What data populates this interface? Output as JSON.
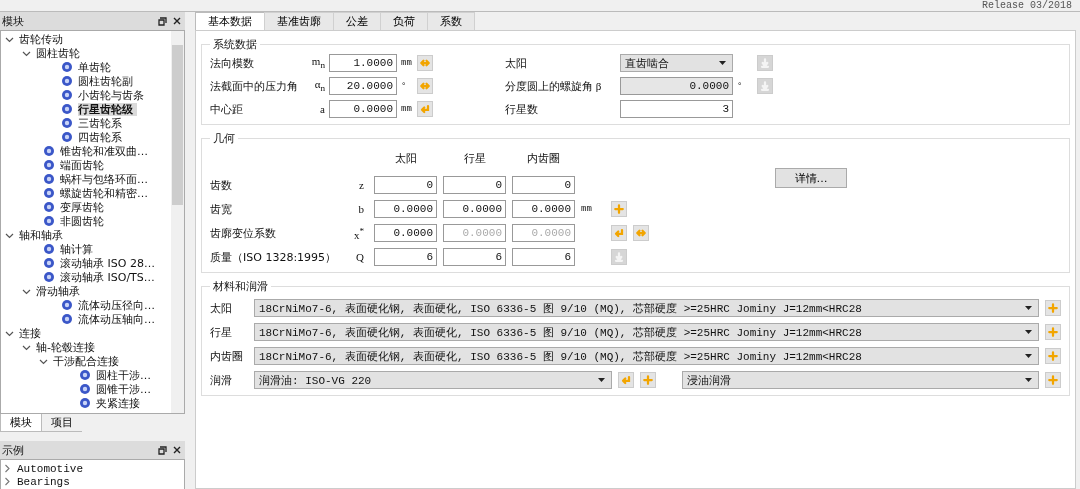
{
  "release": "Release 03/2018",
  "module_panel": {
    "title": "模块",
    "tree": [
      {
        "label": "齿轮传动",
        "expanded": true,
        "selected": false,
        "children": [
          {
            "label": "圆柱齿轮",
            "expanded": true,
            "selected": false,
            "children": [
              {
                "label": "单齿轮",
                "selected": false
              },
              {
                "label": "圆柱齿轮副",
                "selected": false
              },
              {
                "label": "小齿轮与齿条",
                "selected": false
              },
              {
                "label": "行星齿轮级",
                "selected": true
              },
              {
                "label": "三齿轮系",
                "selected": false
              },
              {
                "label": "四齿轮系",
                "selected": false
              }
            ]
          },
          {
            "label": "锥齿轮和准双曲…",
            "selected": false
          },
          {
            "label": "端面齿轮",
            "selected": false
          },
          {
            "label": "蜗杆与包络环面…",
            "selected": false
          },
          {
            "label": "螺旋齿轮和精密…",
            "selected": false
          },
          {
            "label": "变厚齿轮",
            "selected": false
          },
          {
            "label": "非圆齿轮",
            "selected": false
          }
        ]
      },
      {
        "label": "轴和轴承",
        "expanded": true,
        "selected": false,
        "children": [
          {
            "label": "轴计算",
            "selected": false
          },
          {
            "label": "滚动轴承 ISO 28…",
            "selected": false
          },
          {
            "label": "滚动轴承 ISO/TS…",
            "selected": false
          },
          {
            "label": "滑动轴承",
            "expanded": true,
            "selected": false,
            "children": [
              {
                "label": "流体动压径向…",
                "selected": false
              },
              {
                "label": "流体动压轴向…",
                "selected": false
              }
            ]
          }
        ]
      },
      {
        "label": "连接",
        "expanded": true,
        "selected": false,
        "children": [
          {
            "label": "轴-轮毂连接",
            "expanded": true,
            "selected": false,
            "children": [
              {
                "label": "干涉配合连接",
                "expanded": true,
                "selected": false,
                "children": [
                  {
                    "label": "圆柱干涉…",
                    "selected": false
                  },
                  {
                    "label": "圆锥干涉…",
                    "selected": false
                  },
                  {
                    "label": "夹紧连接",
                    "selected": false
                  }
                ]
              }
            ]
          }
        ]
      }
    ],
    "tabs": [
      {
        "label": "模块",
        "selected": true
      },
      {
        "label": "项目",
        "selected": false
      }
    ]
  },
  "examples_panel": {
    "title": "示例",
    "items": [
      {
        "label": "Automotive"
      },
      {
        "label": "Bearings"
      }
    ]
  },
  "tabs": [
    {
      "label": "基本数据",
      "selected": true
    },
    {
      "label": "基准齿廓",
      "selected": false
    },
    {
      "label": "公差",
      "selected": false
    },
    {
      "label": "负荷",
      "selected": false
    },
    {
      "label": "系数",
      "selected": false
    }
  ],
  "system_data": {
    "title": "系统数据",
    "left_rows": [
      {
        "label": "法向模数",
        "symbol": "m$_{n}$",
        "value": "1.0000",
        "unit": "mm",
        "action": {
          "kind": "swap",
          "disabled": false
        }
      },
      {
        "label": "法截面中的压力角",
        "symbol": "α$_{n}$",
        "value": "20.0000",
        "unit": "°",
        "action": {
          "kind": "swap",
          "disabled": false
        }
      },
      {
        "label": "中心距",
        "symbol": "a",
        "value": "0.0000",
        "unit": "mm",
        "action": {
          "kind": "return",
          "disabled": false
        }
      }
    ],
    "right_rows": [
      {
        "label": "太阳",
        "kind": "select",
        "value": "直齿啮合",
        "action": {
          "kind": "apply",
          "disabled": true
        }
      },
      {
        "label": "分度圆上的螺旋角",
        "symbol": "β",
        "kind": "input",
        "value": "0.0000",
        "disabled": true,
        "unit": "°",
        "action": {
          "kind": "apply",
          "disabled": true
        }
      },
      {
        "label": "行星数",
        "kind": "input",
        "value": "3",
        "disabled": false
      }
    ]
  },
  "geometry": {
    "title": "几何",
    "columns": [
      "太阳",
      "行星",
      "内齿圈"
    ],
    "details_button": "详情…",
    "rows": [
      {
        "label": "齿数",
        "symbol": "z",
        "values": [
          {
            "value": "0",
            "disabled": false
          },
          {
            "value": "0",
            "disabled": false
          },
          {
            "value": "0",
            "disabled": false
          }
        ]
      },
      {
        "label": "齿宽",
        "symbol": "b",
        "values": [
          {
            "value": "0.0000",
            "disabled": false
          },
          {
            "value": "0.0000",
            "disabled": false
          },
          {
            "value": "0.0000",
            "disabled": false
          }
        ],
        "unit": "mm",
        "actions": [
          {
            "kind": "plus",
            "disabled": false
          }
        ]
      },
      {
        "label": "齿廓变位系数",
        "symbol": "x$^{*}$",
        "values": [
          {
            "value": "0.0000",
            "disabled": false
          },
          {
            "value": "0.0000",
            "disabled": true
          },
          {
            "value": "0.0000",
            "disabled": true
          }
        ],
        "actions": [
          {
            "kind": "return",
            "disabled": false
          },
          {
            "kind": "swap",
            "disabled": false
          }
        ]
      },
      {
        "label": "质量（ISO 1328:1995）",
        "symbol": "Q",
        "values": [
          {
            "value": "6",
            "disabled": false
          },
          {
            "value": "6",
            "disabled": false
          },
          {
            "value": "6",
            "disabled": false
          }
        ],
        "actions": [
          {
            "kind": "apply",
            "disabled": true
          }
        ]
      }
    ]
  },
  "materials": {
    "title": "材料和润滑",
    "rows": [
      {
        "label": "太阳",
        "items": [
          {
            "kind": "select",
            "value": "18CrNiMo7-6, 表面硬化钢, 表面硬化, ISO 6336-5 图 9/10 (MQ), 芯部硬度 >=25HRC Jominy J=12mm<HRC28"
          },
          {
            "kind": "plus",
            "disabled": false
          }
        ]
      },
      {
        "label": "行星",
        "items": [
          {
            "kind": "select",
            "value": "18CrNiMo7-6, 表面硬化钢, 表面硬化, ISO 6336-5 图 9/10 (MQ), 芯部硬度 >=25HRC Jominy J=12mm<HRC28"
          },
          {
            "kind": "plus",
            "disabled": false
          }
        ]
      },
      {
        "label": "内齿圈",
        "items": [
          {
            "kind": "select",
            "value": "18CrNiMo7-6, 表面硬化钢, 表面硬化, ISO 6336-5 图 9/10 (MQ), 芯部硬度 >=25HRC Jominy J=12mm<HRC28"
          },
          {
            "kind": "plus",
            "disabled": false
          }
        ]
      },
      {
        "label": "润滑",
        "items": [
          {
            "kind": "select",
            "value": "润滑油: ISO-VG 220"
          },
          {
            "kind": "return",
            "disabled": false
          },
          {
            "kind": "plus",
            "disabled": false
          },
          {
            "kind": "select",
            "value": "浸油润滑"
          },
          {
            "kind": "plus",
            "disabled": false
          }
        ]
      }
    ]
  }
}
